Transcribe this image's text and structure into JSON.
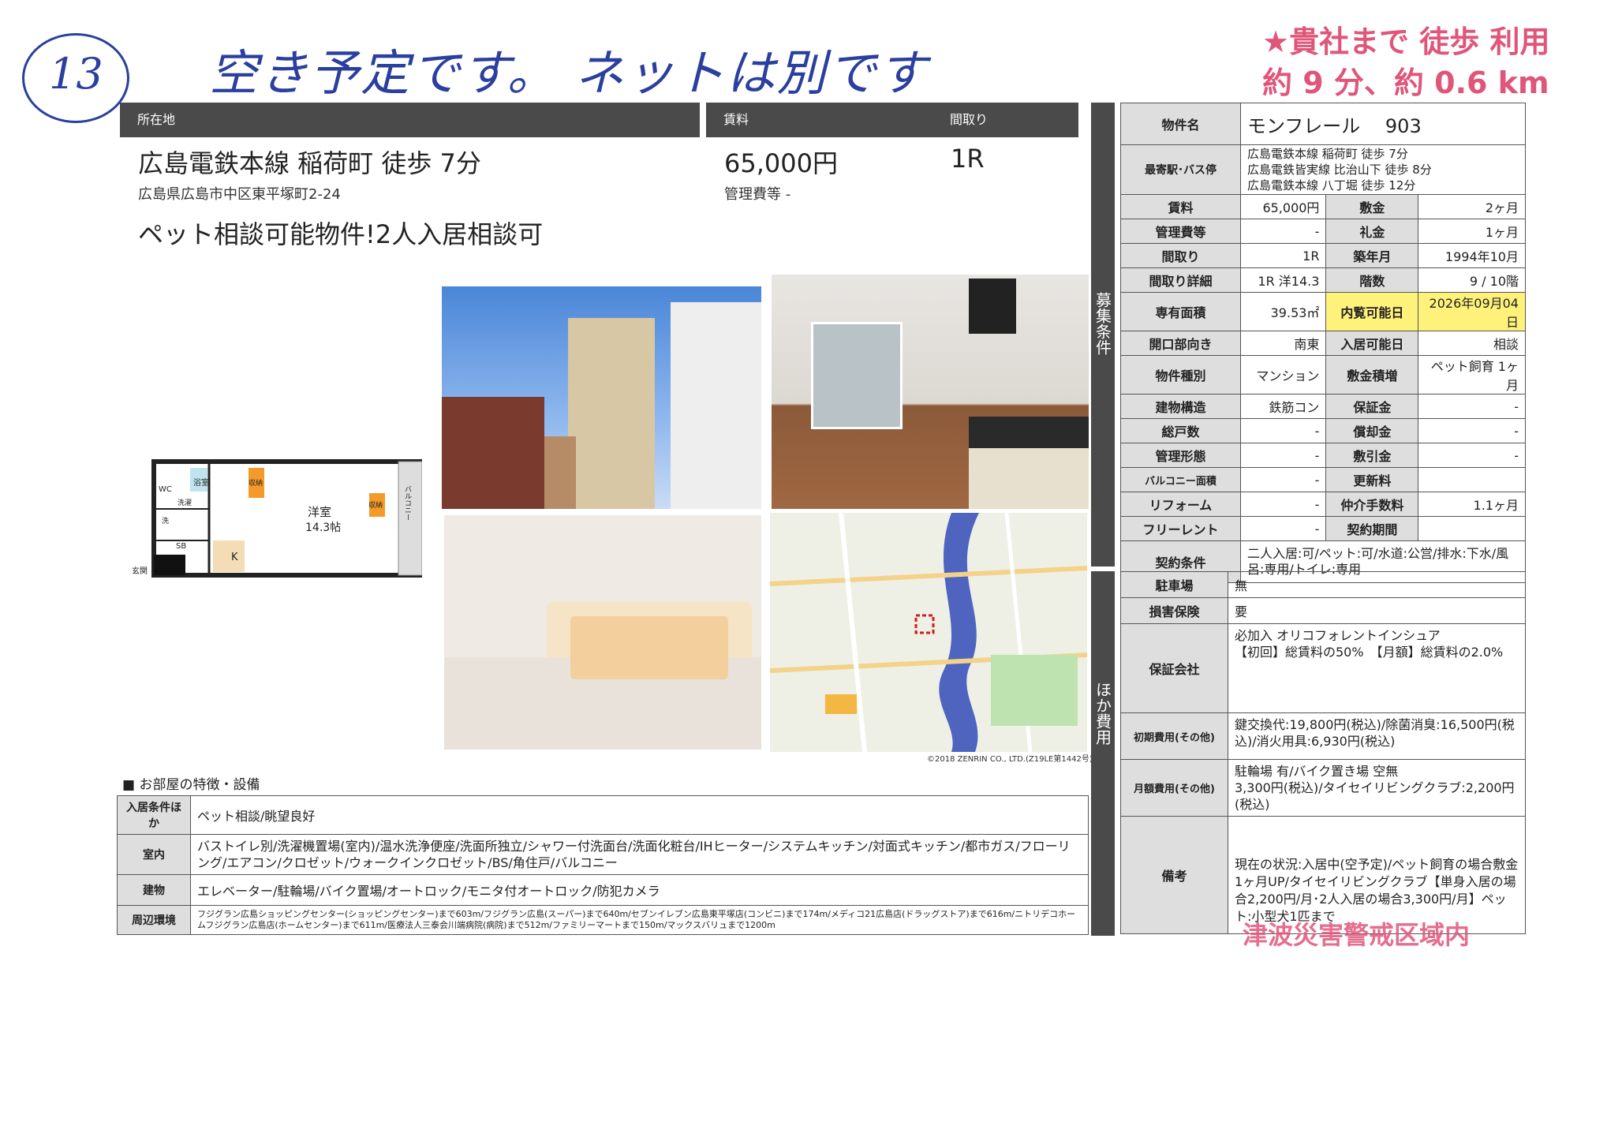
{
  "handwriting": {
    "number": "13",
    "note": "空き予定です。 ネットは別です",
    "stamp_line1": "★貴社まで  徒歩  利用",
    "stamp_line2": "約  9  分、約 0.6  km",
    "stamp_bottom": "津波災害警戒区域内"
  },
  "headers": {
    "location": "所在地",
    "rent": "賃料",
    "layout": "間取り"
  },
  "summary": {
    "station": "広島電鉄本線 稲荷町 徒歩 7分",
    "address": "広島県広島市中区東平塚町2-24",
    "rent": "65,000円",
    "mgmt": "管理費等 -",
    "layout": "1R",
    "catch": "ペット相談可能物件!2人入居相談可"
  },
  "floorplan": {
    "room": "洋室",
    "size": "14.3帖",
    "wc": "WC",
    "bath": "浴室",
    "washer": "洗濯",
    "basin": "洗",
    "entry": "玄関",
    "kitchen": "K",
    "storage1": "収納",
    "storage2": "収納",
    "balcony": "バルコニー",
    "shoes": "SB"
  },
  "map_credit": "©2018 ZENRIN CO., LTD.(Z19LE第1442号)",
  "features": {
    "heading": "■ お部屋の特徴・設備",
    "rows": [
      {
        "label": "入居条件ほか",
        "value": "ペット相談/眺望良好"
      },
      {
        "label": "室内",
        "value": "バストイレ別/洗濯機置場(室内)/温水洗浄便座/洗面所独立/シャワー付洗面台/洗面化粧台/IHヒーター/システムキッチン/対面式キッチン/都市ガス/フローリング/エアコン/クロゼット/ウォークインクロゼット/BS/角住戸/バルコニー"
      },
      {
        "label": "建物",
        "value": "エレベーター/駐輪場/バイク置場/オートロック/モニタ付オートロック/防犯カメラ"
      },
      {
        "label": "周辺環境",
        "value": "フジグラン広島ショッピングセンター(ショッピングセンター)まで603m/フジグラン広島(スーパー)まで640m/セブンイレブン広島東平塚店(コンビニ)まで174m/メディコ21広島店(ドラッグストア)まで616m/ニトリデコホームフジグラン広島店(ホームセンター)まで611m/医療法人三泰会川端病院(病院)まで512m/ファミリーマートまで150m/マックスバリュまで1200m"
      }
    ]
  },
  "property": {
    "name_label": "物件名",
    "name": "モンフレール　 903",
    "station_label": "最寄駅･バス停",
    "stations": [
      "広島電鉄本線 稲荷町 徒歩 7分",
      "広島電鉄皆実線 比治山下 徒歩 8分",
      "広島電鉄本線 八丁堀 徒歩 12分"
    ],
    "side1": "募集条件",
    "side2": "ほか費用",
    "pairs": [
      {
        "l1": "賃料",
        "v1": "65,000円",
        "l2": "敷金",
        "v2": "2ヶ月"
      },
      {
        "l1": "管理費等",
        "v1": "-",
        "l2": "礼金",
        "v2": "1ヶ月"
      },
      {
        "l1": "間取り",
        "v1": "1R",
        "l2": "築年月",
        "v2": "1994年10月"
      },
      {
        "l1": "間取り詳細",
        "v1": "1R 洋14.3",
        "l2": "階数",
        "v2": "9 / 10階"
      },
      {
        "l1": "専有面積",
        "v1": "39.53㎡",
        "l2": "内覧可能日",
        "v2": "2026年09月04日"
      },
      {
        "l1": "開口部向き",
        "v1": "南東",
        "l2": "入居可能日",
        "v2": "相談"
      },
      {
        "l1": "物件種別",
        "v1": "マンション",
        "l2": "敷金積増",
        "v2": "ペット飼育 1ヶ月"
      },
      {
        "l1": "建物構造",
        "v1": "鉄筋コン",
        "l2": "保証金",
        "v2": "-"
      },
      {
        "l1": "総戸数",
        "v1": "-",
        "l2": "償却金",
        "v2": "-"
      },
      {
        "l1": "管理形態",
        "v1": "-",
        "l2": "敷引金",
        "v2": "-"
      },
      {
        "l1": "バルコニー面積",
        "v1": "-",
        "l2": "更新料",
        "v2": ""
      },
      {
        "l1": "リフォーム",
        "v1": "-",
        "l2": "仲介手数料",
        "v2": "1.1ヶ月"
      },
      {
        "l1": "フリーレント",
        "v1": "-",
        "l2": "契約期間",
        "v2": ""
      }
    ],
    "contract_label": "契約条件",
    "contract": "二人入居:可/ペット:可/水道:公営/排水:下水/風呂:専用/トイレ:専用",
    "other": [
      {
        "label": "駐車場",
        "value": "無"
      },
      {
        "label": "損害保険",
        "value": "要"
      },
      {
        "label": "保証会社",
        "value": "必加入 オリコフォレントインシュア\n【初回】総賃料の50%　【月額】総賃料の2.0%"
      },
      {
        "label": "初期費用(その他)",
        "value": "鍵交換代:19,800円(税込)/除菌消臭:16,500円(税込)/消火用具:6,930円(税込)"
      },
      {
        "label": "月額費用(その他)",
        "value": "駐輪場 有/バイク置き場 空無\n3,300円(税込)/タイセイリビングクラブ:2,200円(税込)"
      },
      {
        "label": "備考",
        "value": "現在の状況:入居中(空予定)/ペット飼育の場合敷金1ヶ月UP/タイセイリビングクラブ【単身入居の場合2,200円/月･2人入居の場合3,300円/月】ペット:小型犬1匹まで"
      }
    ]
  },
  "colors": {
    "header": "#4a4a4a",
    "label_bg": "#dedede",
    "highlight": "#fff27a",
    "hand": "#2a3f9e",
    "stamp": "#e0557a"
  }
}
